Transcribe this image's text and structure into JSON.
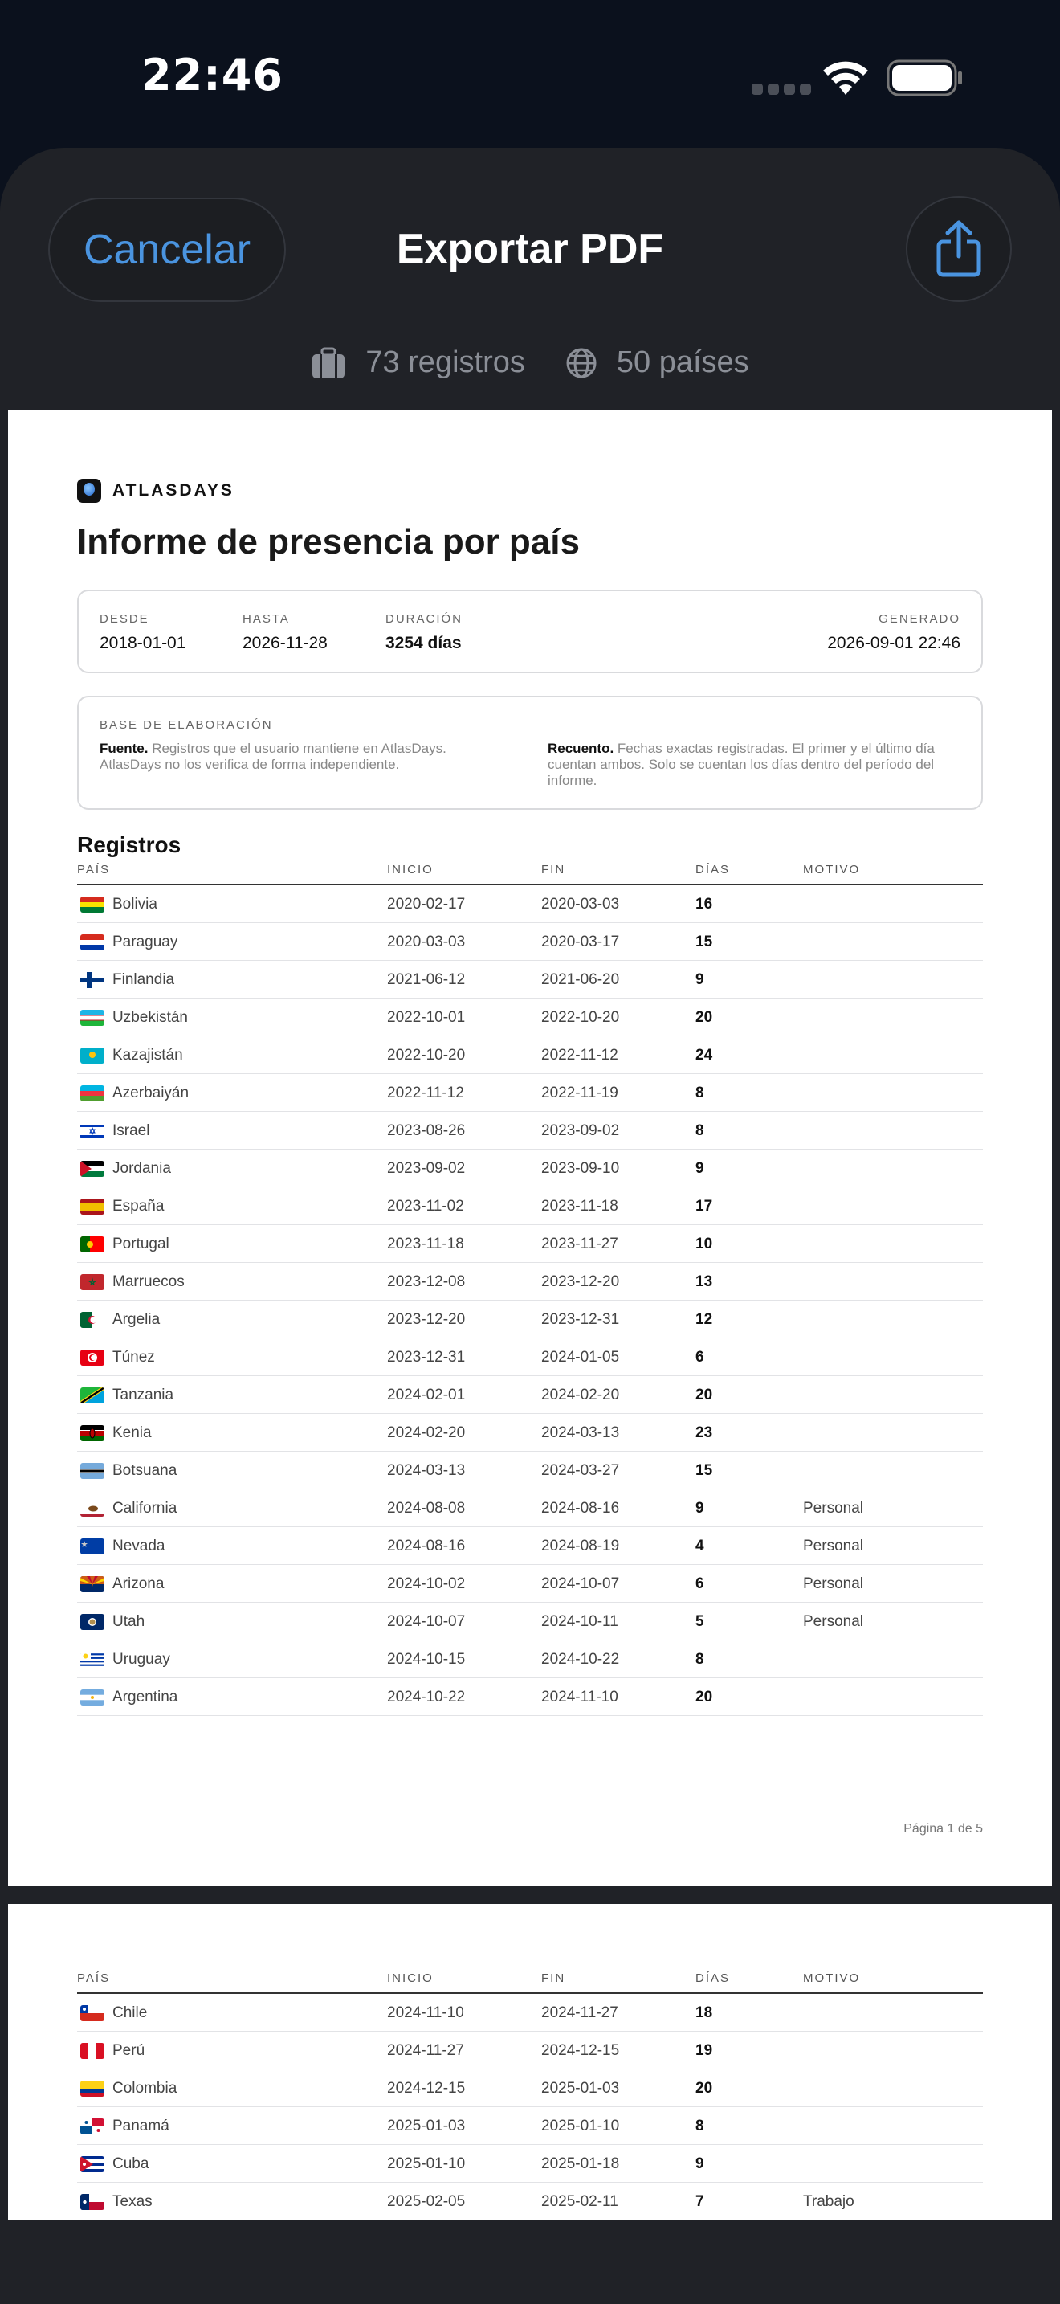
{
  "status_bar": {
    "time": "22:46"
  },
  "sheet": {
    "cancel_label": "Cancelar",
    "title": "Exportar PDF",
    "summary_records": "73 registros",
    "summary_countries": "50 países"
  },
  "report": {
    "brand": "ATLASDAYS",
    "title": "Informe de presencia por país",
    "range": {
      "desde_label": "DESDE",
      "desde_value": "2018-01-01",
      "hasta_label": "HASTA",
      "hasta_value": "2026-11-28",
      "duracion_label": "DURACIÓN",
      "duracion_value": "3254 días",
      "generado_label": "GENERADO",
      "generado_value": "2026-09-01 22:46"
    },
    "basis": {
      "label": "BASE DE ELABORACIÓN",
      "fuente_title": "Fuente.",
      "fuente_text": "Registros que el usuario mantiene en AtlasDays. AtlasDays no los verifica de forma independiente.",
      "recuento_title": "Recuento.",
      "recuento_text": "Fechas exactas registradas. El primer y el último día cuentan ambos. Solo se cuentan los días dentro del período del informe."
    },
    "section_title": "Registros",
    "columns": [
      "PAÍS",
      "INICIO",
      "FIN",
      "DÍAS",
      "MOTIVO"
    ],
    "page1_rows": [
      {
        "country": "Bolivia",
        "start": "2020-02-17",
        "end": "2020-03-03",
        "days": "16",
        "reason": "",
        "flag": "bo"
      },
      {
        "country": "Paraguay",
        "start": "2020-03-03",
        "end": "2020-03-17",
        "days": "15",
        "reason": "",
        "flag": "py"
      },
      {
        "country": "Finlandia",
        "start": "2021-06-12",
        "end": "2021-06-20",
        "days": "9",
        "reason": "",
        "flag": "fi"
      },
      {
        "country": "Uzbekistán",
        "start": "2022-10-01",
        "end": "2022-10-20",
        "days": "20",
        "reason": "",
        "flag": "uz"
      },
      {
        "country": "Kazajistán",
        "start": "2022-10-20",
        "end": "2022-11-12",
        "days": "24",
        "reason": "",
        "flag": "kz"
      },
      {
        "country": "Azerbaiyán",
        "start": "2022-11-12",
        "end": "2022-11-19",
        "days": "8",
        "reason": "",
        "flag": "az"
      },
      {
        "country": "Israel",
        "start": "2023-08-26",
        "end": "2023-09-02",
        "days": "8",
        "reason": "",
        "flag": "il"
      },
      {
        "country": "Jordania",
        "start": "2023-09-02",
        "end": "2023-09-10",
        "days": "9",
        "reason": "",
        "flag": "jo"
      },
      {
        "country": "España",
        "start": "2023-11-02",
        "end": "2023-11-18",
        "days": "17",
        "reason": "",
        "flag": "es"
      },
      {
        "country": "Portugal",
        "start": "2023-11-18",
        "end": "2023-11-27",
        "days": "10",
        "reason": "",
        "flag": "pt"
      },
      {
        "country": "Marruecos",
        "start": "2023-12-08",
        "end": "2023-12-20",
        "days": "13",
        "reason": "",
        "flag": "ma"
      },
      {
        "country": "Argelia",
        "start": "2023-12-20",
        "end": "2023-12-31",
        "days": "12",
        "reason": "",
        "flag": "dz"
      },
      {
        "country": "Túnez",
        "start": "2023-12-31",
        "end": "2024-01-05",
        "days": "6",
        "reason": "",
        "flag": "tn"
      },
      {
        "country": "Tanzania",
        "start": "2024-02-01",
        "end": "2024-02-20",
        "days": "20",
        "reason": "",
        "flag": "tz"
      },
      {
        "country": "Kenia",
        "start": "2024-02-20",
        "end": "2024-03-13",
        "days": "23",
        "reason": "",
        "flag": "ke"
      },
      {
        "country": "Botsuana",
        "start": "2024-03-13",
        "end": "2024-03-27",
        "days": "15",
        "reason": "",
        "flag": "bw"
      },
      {
        "country": "California",
        "start": "2024-08-08",
        "end": "2024-08-16",
        "days": "9",
        "reason": "Personal",
        "flag": "ca"
      },
      {
        "country": "Nevada",
        "start": "2024-08-16",
        "end": "2024-08-19",
        "days": "4",
        "reason": "Personal",
        "flag": "nv"
      },
      {
        "country": "Arizona",
        "start": "2024-10-02",
        "end": "2024-10-07",
        "days": "6",
        "reason": "Personal",
        "flag": "az-us"
      },
      {
        "country": "Utah",
        "start": "2024-10-07",
        "end": "2024-10-11",
        "days": "5",
        "reason": "Personal",
        "flag": "ut"
      },
      {
        "country": "Uruguay",
        "start": "2024-10-15",
        "end": "2024-10-22",
        "days": "8",
        "reason": "",
        "flag": "uy"
      },
      {
        "country": "Argentina",
        "start": "2024-10-22",
        "end": "2024-11-10",
        "days": "20",
        "reason": "",
        "flag": "ar"
      }
    ],
    "page_label": "Página 1 de 5",
    "page2_rows": [
      {
        "country": "Chile",
        "start": "2024-11-10",
        "end": "2024-11-27",
        "days": "18",
        "reason": "",
        "flag": "cl"
      },
      {
        "country": "Perú",
        "start": "2024-11-27",
        "end": "2024-12-15",
        "days": "19",
        "reason": "",
        "flag": "pe"
      },
      {
        "country": "Colombia",
        "start": "2024-12-15",
        "end": "2025-01-03",
        "days": "20",
        "reason": "",
        "flag": "co"
      },
      {
        "country": "Panamá",
        "start": "2025-01-03",
        "end": "2025-01-10",
        "days": "8",
        "reason": "",
        "flag": "pa"
      },
      {
        "country": "Cuba",
        "start": "2025-01-10",
        "end": "2025-01-18",
        "days": "9",
        "reason": "",
        "flag": "cu"
      },
      {
        "country": "Texas",
        "start": "2025-02-05",
        "end": "2025-02-11",
        "days": "7",
        "reason": "Trabajo",
        "flag": "tx"
      }
    ]
  }
}
